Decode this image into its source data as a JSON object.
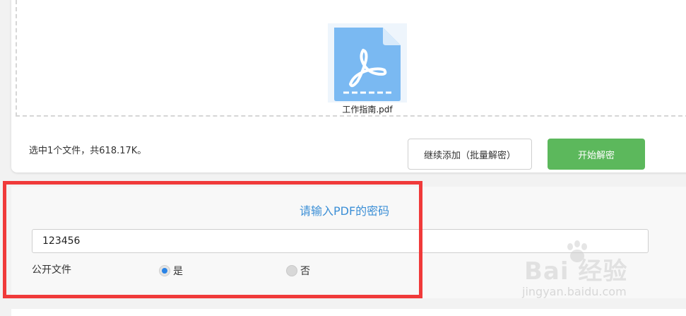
{
  "file": {
    "name": "工作指南.pdf",
    "icon": "pdf-file-icon"
  },
  "summary": "选中1个文件，共618.17K。",
  "buttons": {
    "add_more": "继续添加（批量解密）",
    "start": "开始解密"
  },
  "password": {
    "title": "请输入PDF的密码",
    "value": "123456"
  },
  "public_file": {
    "label": "公开文件",
    "options": [
      {
        "label": "是",
        "checked": true
      },
      {
        "label": "否",
        "checked": false
      }
    ]
  },
  "watermark": {
    "brand": "Bai 经验",
    "url": "jingyan.baidu.com"
  },
  "colors": {
    "accent_green": "#5cb85c",
    "title_blue": "#3c8fd6",
    "highlight_red": "#f03a3a",
    "pdf_icon_blue": "#7ab9f2"
  }
}
